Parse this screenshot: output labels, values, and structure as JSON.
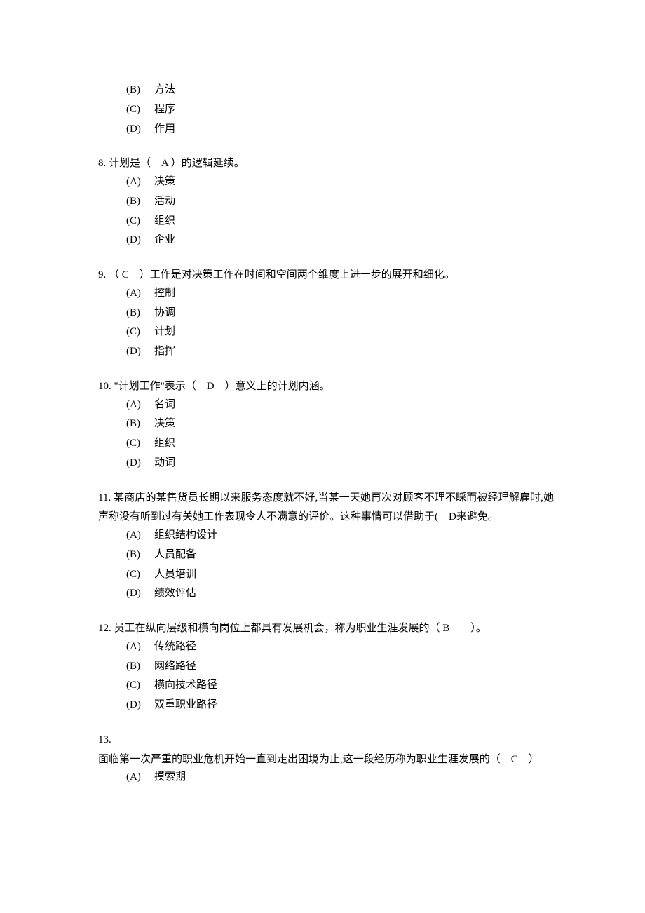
{
  "orphan": {
    "options": [
      {
        "letter": "(B)",
        "text": "方法"
      },
      {
        "letter": "(C)",
        "text": "程序"
      },
      {
        "letter": "(D)",
        "text": "作用"
      }
    ]
  },
  "questions": [
    {
      "number": "8.",
      "text": "计划是（　A ）的逻辑延续。",
      "options": [
        {
          "letter": "(A)",
          "text": "决策"
        },
        {
          "letter": "(B)",
          "text": "活动"
        },
        {
          "letter": "(C)",
          "text": "组织"
        },
        {
          "letter": "(D)",
          "text": "企业"
        }
      ]
    },
    {
      "number": "9.",
      "text": "（ C　）工作是对决策工作在时间和空间两个维度上进一步的展开和细化。",
      "options": [
        {
          "letter": "(A)",
          "text": "控制"
        },
        {
          "letter": "(B)",
          "text": "协调"
        },
        {
          "letter": "(C)",
          "text": "计划"
        },
        {
          "letter": "(D)",
          "text": "指挥"
        }
      ]
    },
    {
      "number": "10.",
      "text": "\"计划工作\"表示（　D　）意义上的计划内涵。",
      "options": [
        {
          "letter": "(A)",
          "text": "名词"
        },
        {
          "letter": "(B)",
          "text": "决策"
        },
        {
          "letter": "(C)",
          "text": "组织"
        },
        {
          "letter": "(D)",
          "text": "动词"
        }
      ]
    },
    {
      "number": "11.",
      "text": "某商店的某售货员长期以来服务态度就不好,当某一天她再次对顾客不理不睬而被经理解雇时,她声称没有听到过有关她工作表现令人不满意的评价。这种事情可以借助于(　D来避免。",
      "options": [
        {
          "letter": "(A)",
          "text": "组织结构设计"
        },
        {
          "letter": "(B)",
          "text": "人员配备"
        },
        {
          "letter": "(C)",
          "text": "人员培训"
        },
        {
          "letter": "(D)",
          "text": "绩效评估"
        }
      ]
    },
    {
      "number": "12.",
      "text": "员工在纵向层级和横向岗位上都具有发展机会，称为职业生涯发展的（ B　　）。",
      "options": [
        {
          "letter": "(A)",
          "text": "传统路径"
        },
        {
          "letter": "(B)",
          "text": "网络路径"
        },
        {
          "letter": "(C)",
          "text": "横向技术路径"
        },
        {
          "letter": "(D)",
          "text": "双重职业路径"
        }
      ]
    },
    {
      "number": "13.",
      "text": "面临第一次严重的职业危机开始一直到走出困境为止,这一段经历称为职业生涯发展的（　C　）",
      "options": [
        {
          "letter": "(A)",
          "text": "摸索期"
        }
      ]
    }
  ]
}
